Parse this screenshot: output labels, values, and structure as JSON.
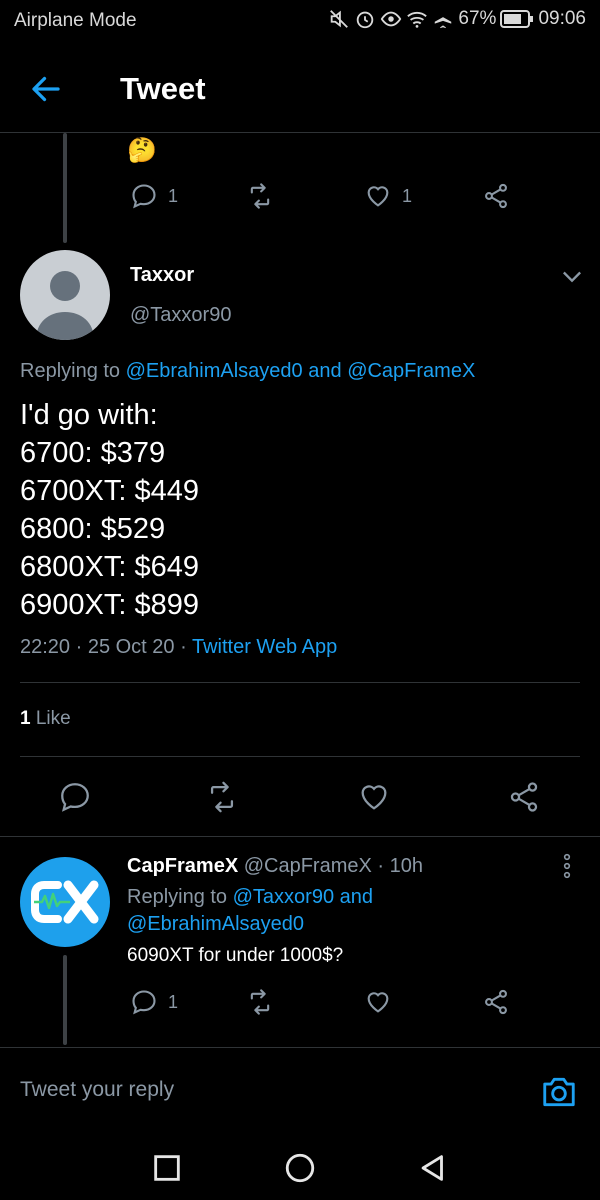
{
  "status_bar": {
    "mode": "Airplane Mode",
    "battery": "67%",
    "time": "09:06"
  },
  "header": {
    "title": "Tweet"
  },
  "parent_tweet": {
    "emoji": "🤔",
    "reply_count": "1",
    "like_count": "1"
  },
  "main_tweet": {
    "name": "Taxxor",
    "handle": "@Taxxor90",
    "replying_prefix": "Replying to",
    "replying_user1": "@EbrahimAlsayed0",
    "replying_and": "and",
    "replying_user2": "@CapFrameX",
    "lines": [
      "I'd go with:",
      "6700: $379",
      "6700XT: $449",
      "6800: $529",
      "6800XT: $649",
      "6900XT: $899"
    ],
    "time": "22:20 · 25 Oct 20 ·",
    "source": "Twitter Web App",
    "likes_count": "1",
    "likes_label": "Like"
  },
  "reply_tweet": {
    "name": "CapFrameX",
    "handle": "@CapFrameX",
    "age": "· 10h",
    "replying_prefix": "Replying to",
    "replying_user1": "@Taxxor90",
    "replying_and": "and",
    "replying_user2": "@EbrahimAlsayed0",
    "text": "6090XT for under 1000$?",
    "reply_count": "1"
  },
  "compose": {
    "placeholder": "Tweet your reply"
  },
  "icons": {
    "back": "arrow-left-icon",
    "reply": "speech-bubble-icon",
    "retweet": "retweet-icon",
    "like": "heart-icon",
    "share": "share-icon",
    "camera": "camera-icon"
  },
  "colors": {
    "accent": "#1da1f2",
    "muted": "#8b98a5",
    "background": "#000000",
    "divider": "#2f3336"
  }
}
